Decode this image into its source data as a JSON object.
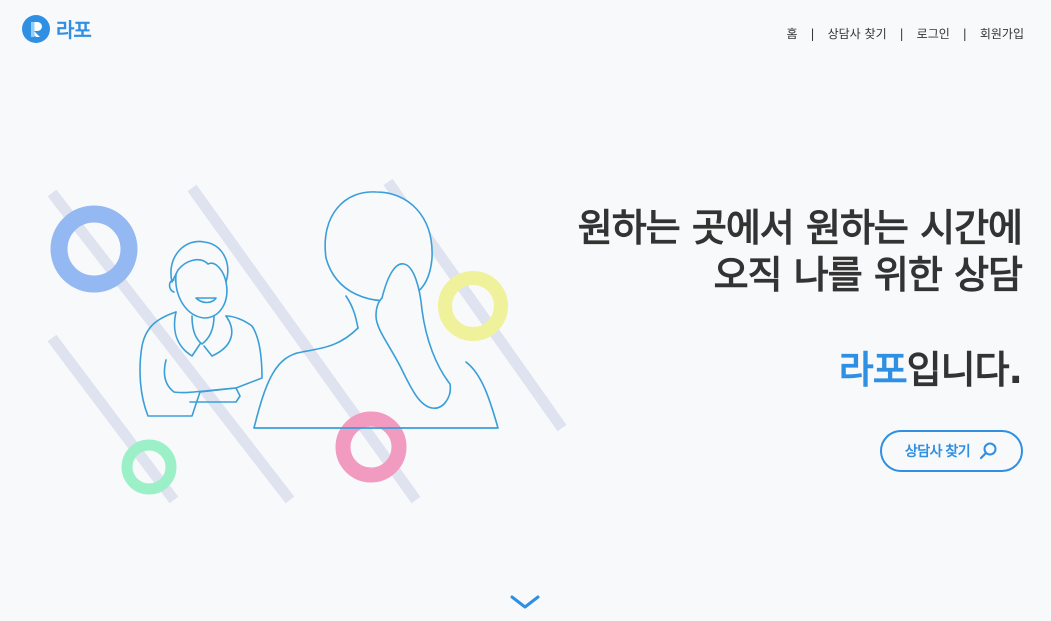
{
  "header": {
    "logo_text": "라포",
    "nav": [
      {
        "label": "홈"
      },
      {
        "label": "상담사 찾기"
      },
      {
        "label": "로그인"
      },
      {
        "label": "회원가입"
      }
    ],
    "separator": "|"
  },
  "hero": {
    "line1": "원하는 곳에서 원하는 시간에",
    "line2": "오직 나를 위한 상담",
    "brand": "라포",
    "brand_suffix": "입니다."
  },
  "cta": {
    "label": "상담사 찾기",
    "icon": "search-icon"
  },
  "scroll": {
    "icon": "chevron-down-icon"
  },
  "colors": {
    "accent": "#2f8fe3",
    "text": "#333333",
    "background": "#f8f9fa",
    "ring_blue": "#93b8f2",
    "ring_yellow": "#f0f29b",
    "ring_pink": "#f19bc0",
    "ring_green": "#9bf0c8"
  }
}
